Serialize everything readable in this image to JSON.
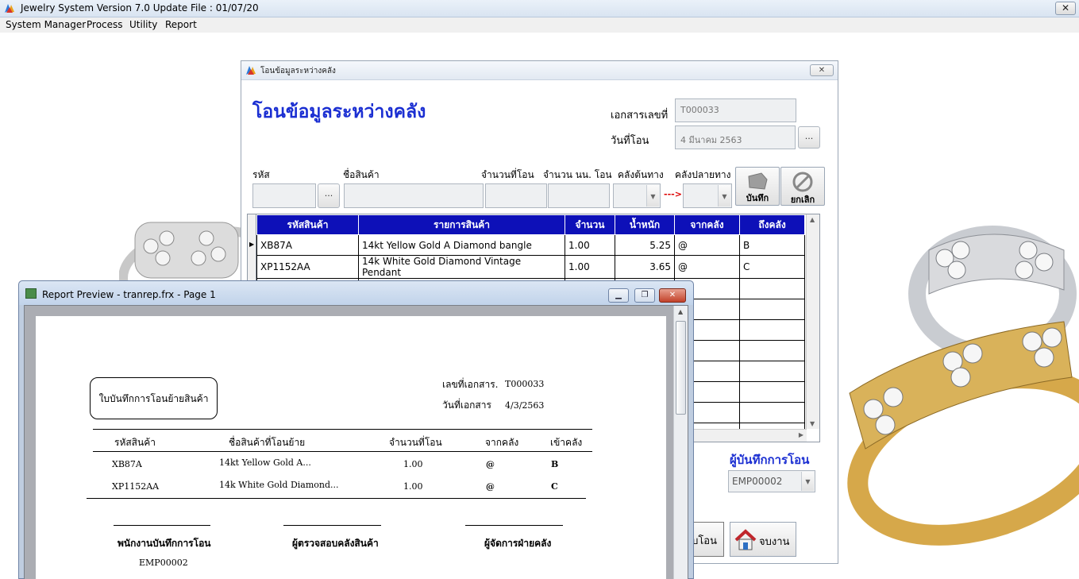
{
  "app": {
    "title": "Jewelry System Version 7.0 Update File : 01/07/20",
    "close": "✕",
    "menu": [
      "System Manager",
      "Process",
      "Utility",
      "Report"
    ]
  },
  "transfer_window": {
    "title": "โอนข้อมูลระหว่างคลัง",
    "close": "✕",
    "heading": "โอนข้อมูลระหว่างคลัง",
    "doc_no_label": "เอกสารเลขที่",
    "doc_no_value": "T000033",
    "date_label": "วันที่โอน",
    "date_value": "4 มีนาคม 2563",
    "dots": "...",
    "entry": {
      "code_label": "รหัส",
      "name_label": "ชื่อสินค้า",
      "qty_label": "จำนวนที่โอน",
      "weight_label": "จำนวน นน. โอน",
      "from_label": "คลังต้นทาง",
      "to_label": "คลังปลายทาง",
      "arrow": "--->",
      "save_label": "บันทึก",
      "cancel_label": "ยกเลิก"
    },
    "grid": {
      "columns": [
        "รหัสสินค้า",
        "รายการสินค้า",
        "จำนวน",
        "น้ำหนัก",
        "จากคลัง",
        "ถึงคลัง"
      ],
      "rows": [
        {
          "code": "XB87A",
          "name": "14kt Yellow Gold A Diamond bangle",
          "qty": "1.00",
          "weight": "5.25",
          "from": "@",
          "to": "B"
        },
        {
          "code": "XP1152AA",
          "name": "14k White Gold Diamond Vintage Pendant",
          "qty": "1.00",
          "weight": "3.65",
          "from": "@",
          "to": "C"
        }
      ]
    },
    "recorder_label": "ผู้บันทึกการโอน",
    "recorder_value": "EMP00002",
    "transfer_button": "บโอน",
    "exit_button": "จบงาน"
  },
  "report_preview": {
    "title": "Report Preview - tranrep.frx - Page 1",
    "doc_title": "ใบบันทึกการโอนย้ายสินค้า",
    "doc_no_label": "เลขที่เอกสาร.",
    "doc_no_value": "T000033",
    "date_label": "วันที่เอกสาร",
    "date_value": "4/3/2563",
    "columns": [
      "รหัสสินค้า",
      "ชื่อสินค้าที่โอนย้าย",
      "จำนวนที่โอน",
      "จากคลัง",
      "เข้าคลัง"
    ],
    "rows": [
      {
        "code": "XB87A",
        "name": "14kt Yellow Gold A...",
        "qty": "1.00",
        "from": "@",
        "to": "B"
      },
      {
        "code": "XP1152AA",
        "name": "14k White Gold Diamond...",
        "qty": "1.00",
        "from": "@",
        "to": "C"
      }
    ],
    "signatures": [
      "พนักงานบันทึกการโอน",
      "ผู้ตรวจสอบคลังสินค้า",
      "ผู้จัดการฝ่ายคลัง"
    ],
    "employee": "EMP00002"
  }
}
